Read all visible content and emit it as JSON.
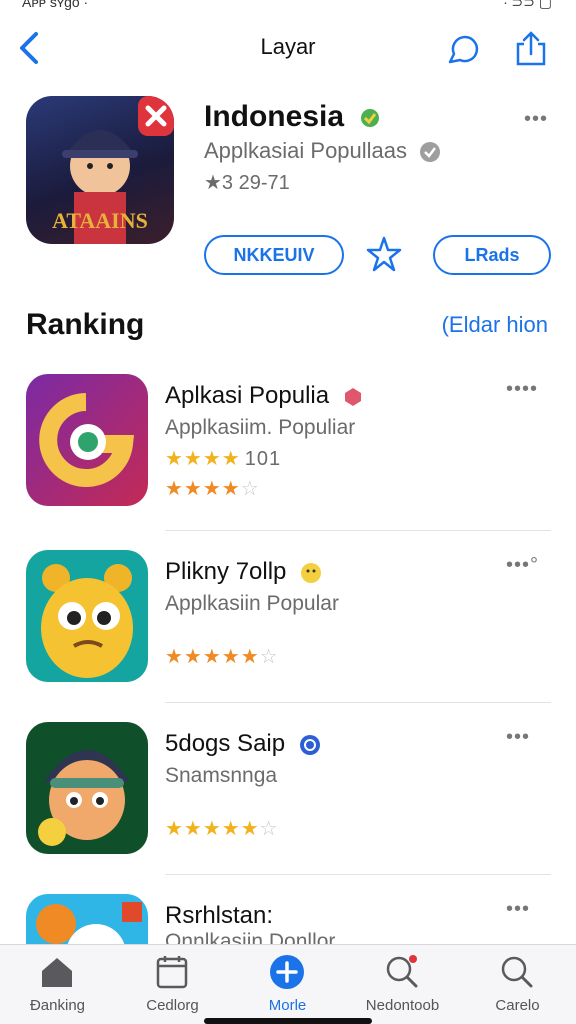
{
  "status": {
    "left": "Aᴘᴘ sʏgo ·",
    "right": "∙ ⊃⊃ ▢"
  },
  "nav": {
    "title": "Layar"
  },
  "hero": {
    "icon_text": "ATAAINS",
    "title": "Indonesia",
    "subtitle": "Applkasiai Popullaas",
    "rating": "★3 29-71",
    "button_left": "NKKEUIV",
    "button_right": "LRads"
  },
  "section": {
    "title": "Ranking",
    "link": "(Eldar hion"
  },
  "rows": [
    {
      "name": "Aplkasi Populia",
      "sub": "Applkasiim. Populiar",
      "rating_text": "101",
      "stars1": 4,
      "stars2": 4,
      "color": "#8b2a8f"
    },
    {
      "name": "Plikny 7ollp",
      "sub": "Applkasiin Popular",
      "stars2": 4,
      "color": "#15a5a0"
    },
    {
      "name": "5dogs Saip",
      "sub": "Snamsnnga",
      "stars2": 4,
      "color": "#0f4f2a"
    },
    {
      "name": "Rsrhlstan:",
      "sub": "Onnlkasiin Donllor",
      "color": "#2fb5e6"
    }
  ],
  "tabs": [
    {
      "label": "Ðanking",
      "icon": "home-icon"
    },
    {
      "label": "Cedlorg",
      "icon": "calendar-icon"
    },
    {
      "label": "Morle",
      "icon": "add-circle-icon"
    },
    {
      "label": "Nedontoob",
      "icon": "search-notify-icon"
    },
    {
      "label": "Carelo",
      "icon": "search-icon"
    }
  ],
  "colors": {
    "accent": "#1a73e8",
    "star": "#f2b21c"
  }
}
